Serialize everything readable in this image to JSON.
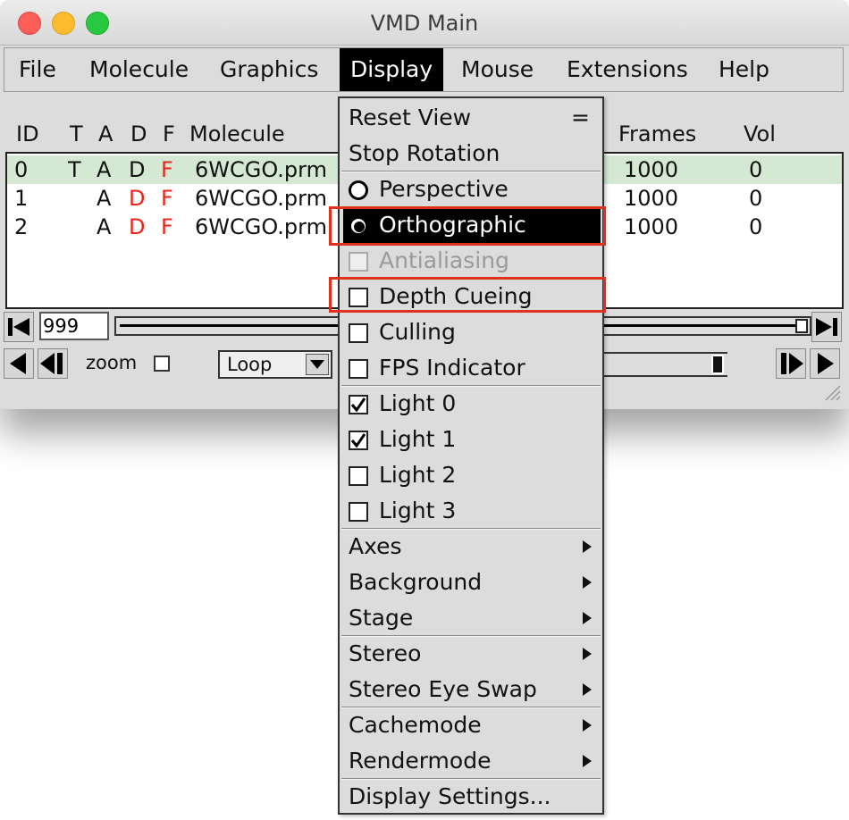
{
  "window": {
    "title": "VMD Main"
  },
  "menubar": {
    "items": [
      {
        "label": "File"
      },
      {
        "label": "Molecule"
      },
      {
        "label": "Graphics"
      },
      {
        "label": "Display",
        "active": true
      },
      {
        "label": "Mouse"
      },
      {
        "label": "Extensions"
      },
      {
        "label": "Help"
      }
    ]
  },
  "molecule_list": {
    "columns": [
      "ID",
      "T",
      "A",
      "D",
      "F",
      "Molecule",
      "Frames",
      "Vol"
    ],
    "rows": [
      {
        "id": "0",
        "t": "T",
        "a": "A",
        "d": "D",
        "f": "F",
        "molecule": "6WCGO.prm",
        "frames": "1000",
        "vol": "0",
        "selected": true
      },
      {
        "id": "1",
        "t": "",
        "a": "A",
        "d": "D",
        "f": "F",
        "molecule": "6WCGO.prm",
        "frames": "1000",
        "vol": "0",
        "selected": false
      },
      {
        "id": "2",
        "t": "",
        "a": "A",
        "d": "D",
        "f": "F",
        "molecule": "6WCGO.prm",
        "frames": "1000",
        "vol": "0",
        "selected": false
      }
    ],
    "colors": {
      "selected_row": "#d5e8d4",
      "inactive_flag": "#e5261c"
    }
  },
  "animation": {
    "frame_value": "999",
    "zoom_label": "zoom",
    "loop_value": "Loop"
  },
  "display_menu": {
    "reset_view": "Reset View",
    "reset_view_shortcut": "=",
    "stop_rotation": "Stop Rotation",
    "perspective": "Perspective",
    "orthographic": "Orthographic",
    "antialiasing": "Antialiasing",
    "depth_cueing": "Depth Cueing",
    "culling": "Culling",
    "fps_indicator": "FPS Indicator",
    "light0": "Light 0",
    "light1": "Light 1",
    "light2": "Light 2",
    "light3": "Light 3",
    "axes": "Axes",
    "background": "Background",
    "stage": "Stage",
    "stereo": "Stereo",
    "stereo_eye_swap": "Stereo Eye Swap",
    "cachemode": "Cachemode",
    "rendermode": "Rendermode",
    "display_settings": "Display Settings...",
    "annotation_color": "#e0301e"
  }
}
